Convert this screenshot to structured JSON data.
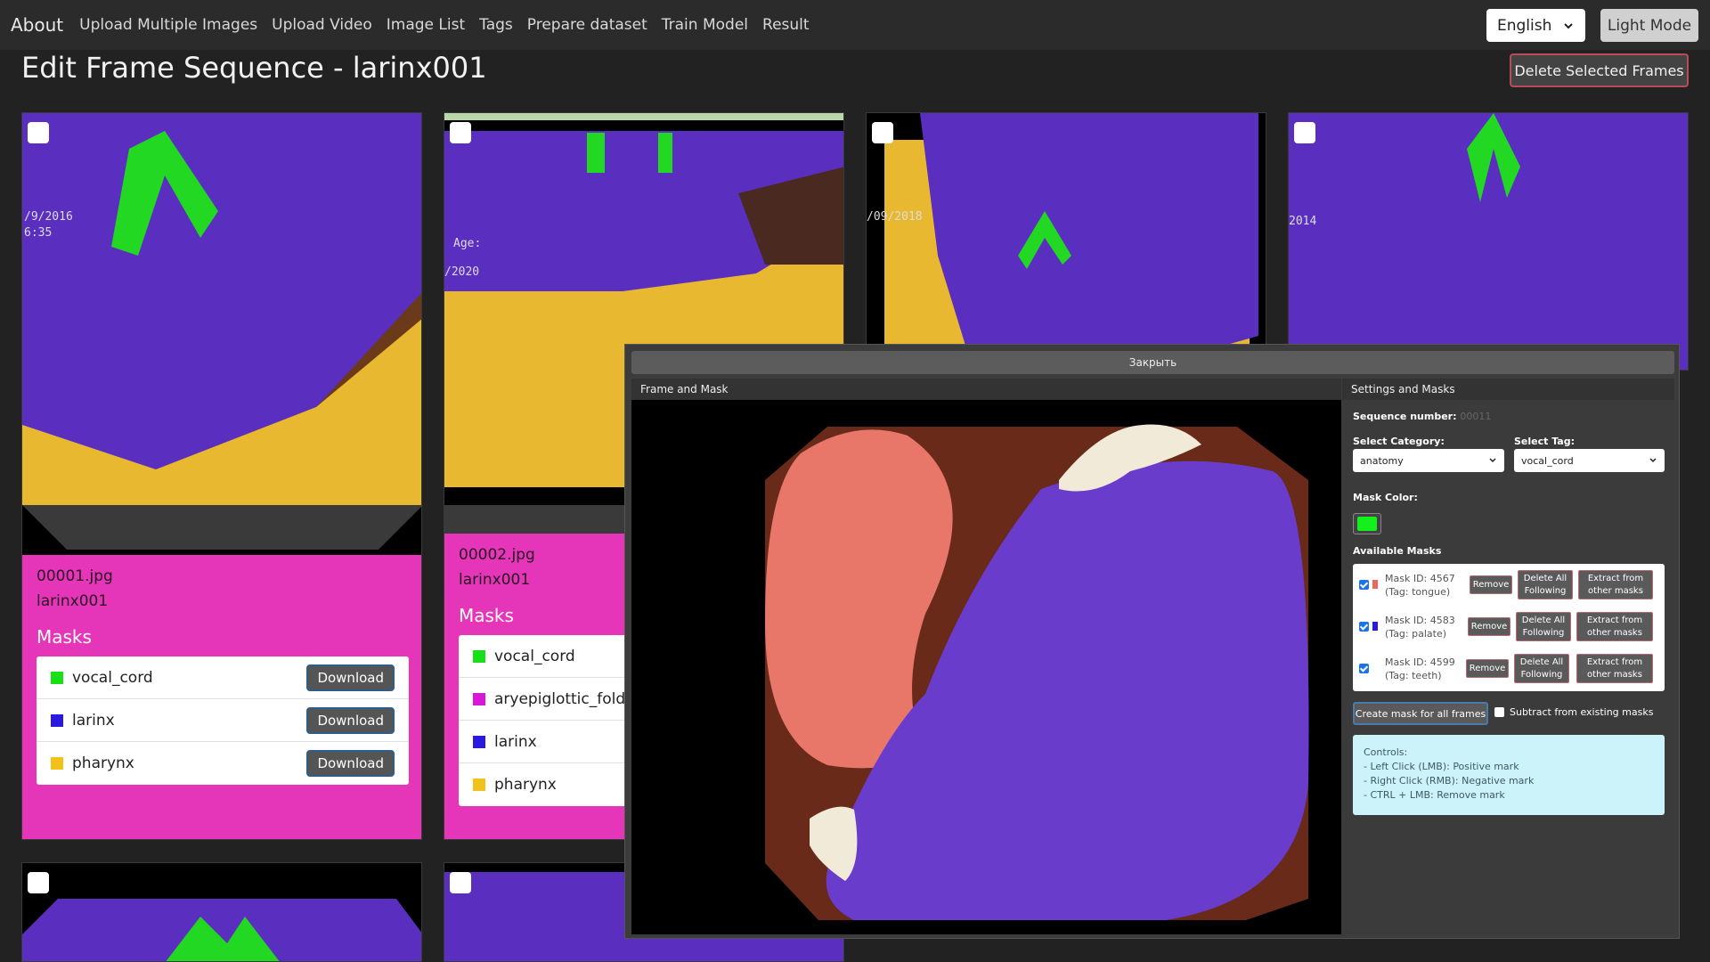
{
  "navbar": {
    "brand": "About",
    "links": [
      "Upload Multiple Images",
      "Upload Video",
      "Image List",
      "Tags",
      "Prepare dataset",
      "Train Model",
      "Result"
    ],
    "language": "English",
    "mode_button": "Light Mode"
  },
  "page": {
    "title": "Edit Frame Sequence - larinx001",
    "delete_button": "Delete Selected Frames"
  },
  "frames": [
    {
      "filename": "00001.jpg",
      "sequence": "larinx001",
      "masks_title": "Masks",
      "download_label": "Download",
      "masks": [
        {
          "name": "vocal_cord",
          "color": "#18e018"
        },
        {
          "name": "larinx",
          "color": "#2a1ae0"
        },
        {
          "name": "pharynx",
          "color": "#f2c21a"
        }
      ]
    },
    {
      "filename": "00002.jpg",
      "sequence": "larinx001",
      "masks_title": "Masks",
      "masks": [
        {
          "name": "vocal_cord",
          "color": "#18e018"
        },
        {
          "name": "aryepiglottic_fold",
          "color": "#d718d7"
        },
        {
          "name": "larinx",
          "color": "#2a1ae0"
        },
        {
          "name": "pharynx",
          "color": "#f2c21a"
        }
      ]
    }
  ],
  "modal": {
    "close_label": "Закрыть",
    "frame_pane_title": "Frame and Mask",
    "settings_pane_title": "Settings and Masks",
    "sequence_label": "Sequence number:",
    "sequence_value": "00011",
    "category_label": "Select Category:",
    "category_value": "anatomy",
    "tag_label": "Select Tag:",
    "tag_value": "vocal_cord",
    "mask_color_label": "Mask Color:",
    "mask_color": "#13f01b",
    "available_masks_label": "Available Masks",
    "available_masks": [
      {
        "id_text": "Mask ID: 4567",
        "tag_text": "(Tag: tongue)",
        "color": "#e86a5a"
      },
      {
        "id_text": "Mask ID: 4583",
        "tag_text": "(Tag: palate)",
        "color": "#2a1ae0"
      },
      {
        "id_text": "Mask ID: 4599",
        "tag_text": "(Tag: teeth)",
        "color": "#ffffff"
      }
    ],
    "remove_label": "Remove",
    "delete_following_line1": "Delete All",
    "delete_following_line2": "Following",
    "extract_line1": "Extract from",
    "extract_line2": "other masks",
    "create_mask_label": "Create mask for all frames",
    "subtract_label": "Subtract from existing masks",
    "controls_title": "Controls:",
    "controls_lines": [
      "- Left Click (LMB): Positive mark",
      "- Right Click (RMB): Negative mark",
      "- CTRL + LMB: Remove mark"
    ]
  }
}
